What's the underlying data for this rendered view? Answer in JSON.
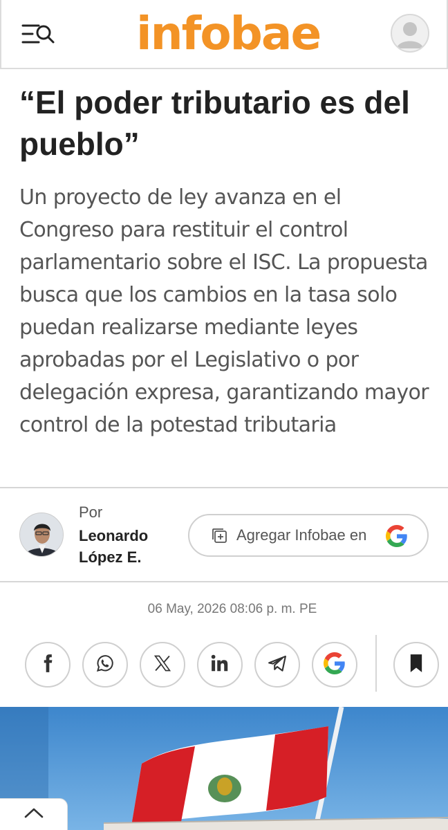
{
  "header": {
    "logo_text": "infobae",
    "logo_color": "#f39326"
  },
  "article": {
    "headline": "“El poder tributario es del pueblo”",
    "summary": "Un proyecto de ley avanza en el Congreso para restituir el control parlamentario sobre el ISC. La propuesta busca que los cambios en la tasa solo puedan realizarse mediante leyes aprobadas por el Legislativo o por delegación expresa, garantizando mayor control de la potestad tributaria",
    "by_label": "Por",
    "author": "Leonardo López E.",
    "add_source_label": "Agregar Infobae en",
    "date": "06 May, 2026 08:06 p. m. PE"
  },
  "share": {
    "items": [
      "facebook-icon",
      "whatsapp-icon",
      "x-icon",
      "linkedin-icon",
      "telegram-icon",
      "google-icon"
    ],
    "save": "bookmark-icon"
  },
  "icons": {
    "menu": "menu-search-icon",
    "user": "user-icon",
    "add": "add-to-collection-icon",
    "scroll": "chevron-up-icon"
  }
}
